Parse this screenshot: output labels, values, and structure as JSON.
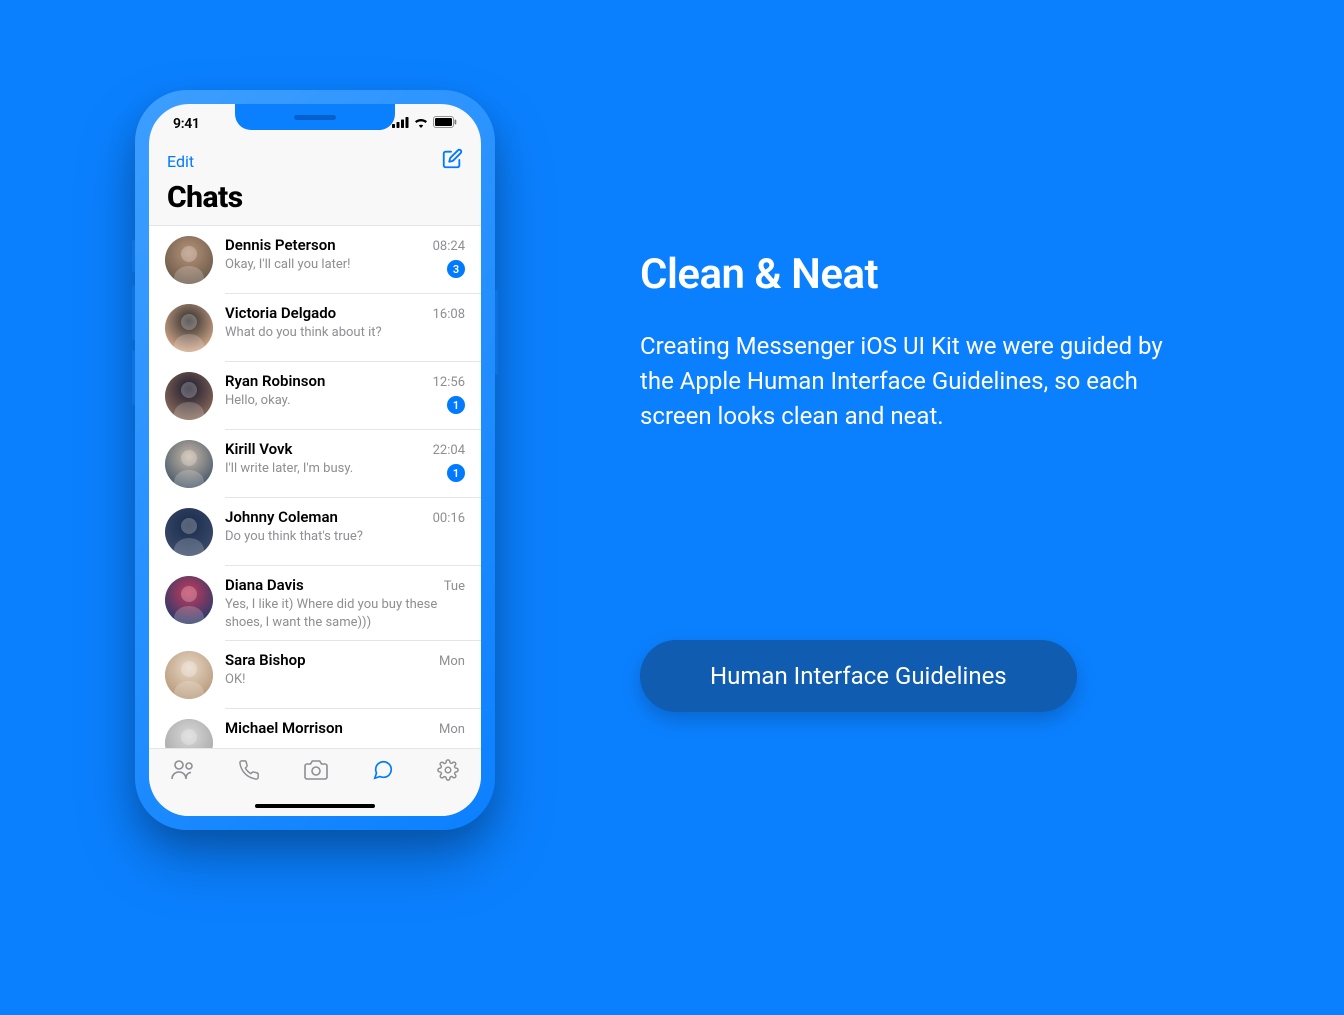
{
  "status": {
    "time": "9:41"
  },
  "header": {
    "edit": "Edit",
    "title": "Chats"
  },
  "chats": [
    {
      "name": "Dennis Peterson",
      "msg": "Okay, I'll call you later!",
      "time": "08:24",
      "badge": "3",
      "avatar": "m1"
    },
    {
      "name": "Victoria Delgado",
      "msg": "What do you think about it?",
      "time": "16:08",
      "badge": "",
      "avatar": "f1"
    },
    {
      "name": "Ryan Robinson",
      "msg": "Hello, okay.",
      "time": "12:56",
      "badge": "1",
      "avatar": "m2"
    },
    {
      "name": "Kirill Vovk",
      "msg": "I'll write later, I'm busy.",
      "time": "22:04",
      "badge": "1",
      "avatar": "m3"
    },
    {
      "name": "Johnny Coleman",
      "msg": "Do you think that's true?",
      "time": "00:16",
      "badge": "",
      "avatar": "m4"
    },
    {
      "name": "Diana Davis",
      "msg": "Yes, I like it) Where did you buy these shoes, I want the same)))",
      "time": "Tue",
      "badge": "",
      "avatar": "f2"
    },
    {
      "name": "Sara Bishop",
      "msg": "OK!",
      "time": "Mon",
      "badge": "",
      "avatar": "f3"
    },
    {
      "name": "Michael Morrison",
      "msg": "",
      "time": "Mon",
      "badge": "",
      "avatar": "m5"
    }
  ],
  "marketing": {
    "title": "Clean & Neat",
    "body": "Creating Messenger iOS UI Kit we were guided by the Apple Human Interface Guidelines, so each screen looks clean and neat.",
    "cta": "Human Interface Guidelines"
  },
  "colors": {
    "accent": "#007aff",
    "bg": "#0b80ff",
    "cta_bg": "#0f5cb0"
  }
}
